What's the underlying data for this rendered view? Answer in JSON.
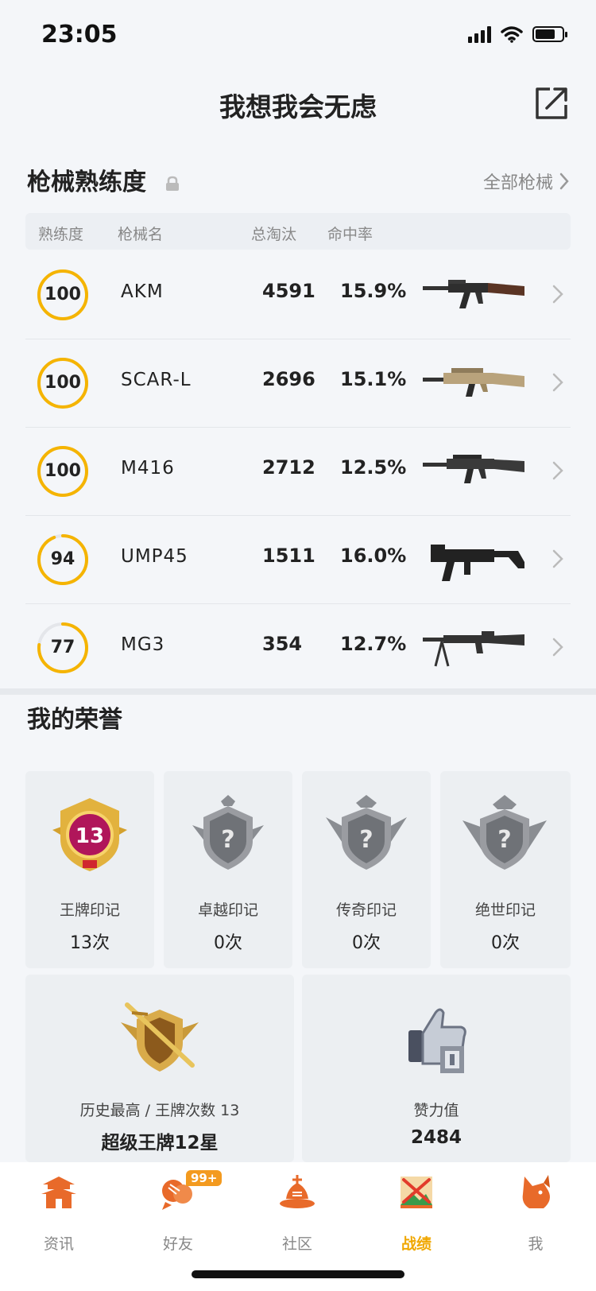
{
  "status_bar": {
    "time": "23:05"
  },
  "header": {
    "title": "我想我会无虑"
  },
  "weapons_section": {
    "title": "枪械熟练度",
    "all_link": "全部枪械",
    "columns": {
      "proficiency": "熟练度",
      "name": "枪械名",
      "kills": "总淘汰",
      "hit_rate": "命中率"
    },
    "rows": [
      {
        "proficiency": "100",
        "proficiency_fraction": 1.0,
        "name": "AKM",
        "kills": "4591",
        "hit_rate": "15.9%",
        "gun": "akm-rifle",
        "stock_color": "#5a3424"
      },
      {
        "proficiency": "100",
        "proficiency_fraction": 1.0,
        "name": "SCAR-L",
        "kills": "2696",
        "hit_rate": "15.1%",
        "gun": "scar-rifle",
        "stock_color": "#b9a37c"
      },
      {
        "proficiency": "100",
        "proficiency_fraction": 1.0,
        "name": "M416",
        "kills": "2712",
        "hit_rate": "12.5%",
        "gun": "m416-rifle",
        "stock_color": "#3a3a3a"
      },
      {
        "proficiency": "94",
        "proficiency_fraction": 0.94,
        "name": "UMP45",
        "kills": "1511",
        "hit_rate": "16.0%",
        "gun": "ump45-smg",
        "stock_color": "#222222"
      },
      {
        "proficiency": "77",
        "proficiency_fraction": 0.77,
        "name": "MG3",
        "kills": "354",
        "hit_rate": "12.7%",
        "gun": "mg3-lmg",
        "stock_color": "#333333"
      }
    ]
  },
  "honors_section": {
    "title": "我的荣誉",
    "badges": [
      {
        "label": "王牌印记",
        "count": "13次",
        "icon": "ace-emblem-icon",
        "number": "13"
      },
      {
        "label": "卓越印记",
        "count": "0次",
        "icon": "excellence-emblem-locked-icon"
      },
      {
        "label": "传奇印记",
        "count": "0次",
        "icon": "legend-emblem-locked-icon"
      },
      {
        "label": "绝世印记",
        "count": "0次",
        "icon": "peerless-emblem-locked-icon"
      }
    ],
    "history": {
      "label": "历史最高 / 王牌次数 13",
      "value": "超级王牌12星",
      "icon": "rank-crest-icon"
    },
    "likes": {
      "label": "赞力值",
      "value": "2484",
      "icon": "thumbs-up-trophy-icon"
    }
  },
  "bottom_nav": {
    "items": [
      {
        "label": "资讯",
        "icon": "pagoda-icon"
      },
      {
        "label": "好友",
        "icon": "friends-icon",
        "badge": "99+"
      },
      {
        "label": "社区",
        "icon": "community-icon"
      },
      {
        "label": "战绩",
        "icon": "battle-record-icon",
        "active": true
      },
      {
        "label": "我",
        "icon": "profile-fox-icon"
      }
    ]
  },
  "colors": {
    "accent": "#f5b400",
    "active_tab": "#f0a700",
    "nav_icon": "#e86a2a"
  }
}
